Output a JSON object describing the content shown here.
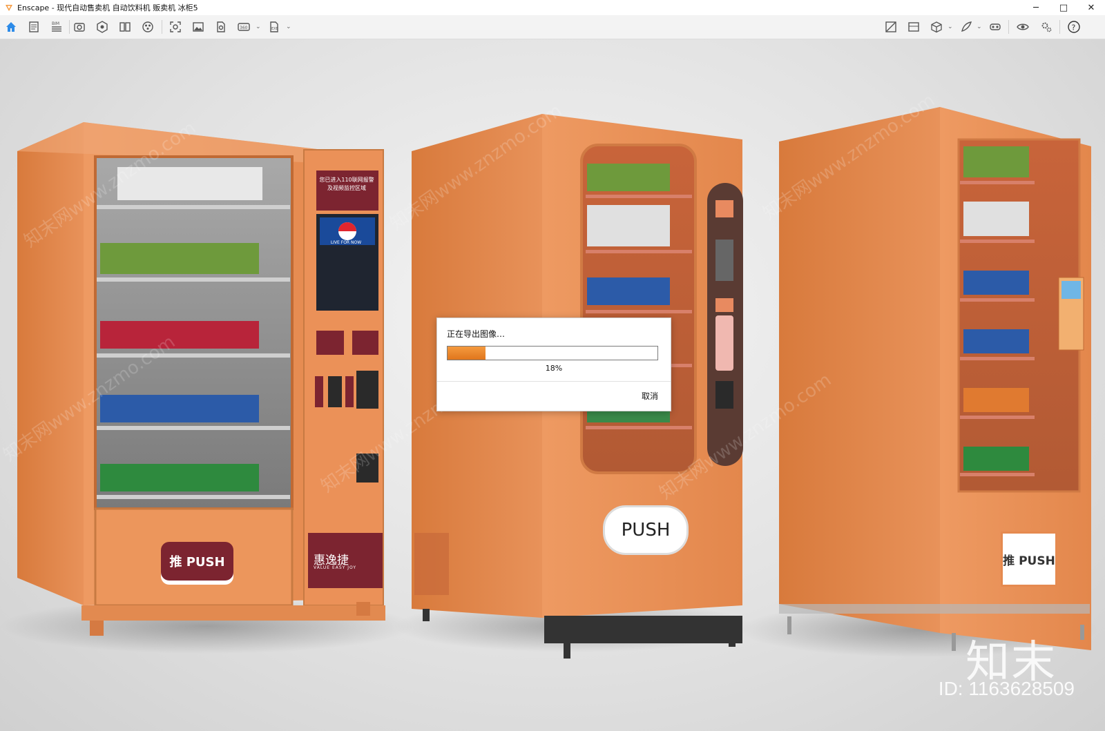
{
  "window": {
    "title": "Enscape - 现代自动售卖机 自动饮料机 贩卖机 冰柜5",
    "minimize": "─",
    "maximize": "□",
    "close": "✕"
  },
  "toolbar": {
    "left_icons": [
      "home-icon",
      "document-icon",
      "list-icon",
      "camera-view-icon",
      "bim-icon",
      "book-icon",
      "asset-icon",
      "screenshot-icon",
      "image-icon",
      "export-icon",
      "panorama-icon",
      "exe-icon"
    ],
    "right_icons": [
      "material-icon",
      "atmosphere-icon",
      "cube-icon",
      "feather-icon",
      "vr-icon",
      "eye-icon",
      "settings-icon",
      "help-icon"
    ],
    "bim_label": "BIM",
    "panorama_label": "360",
    "exe_label": "EXE",
    "collapse": "⌃"
  },
  "scene": {
    "left_machine": {
      "push_label": "推 PUSH",
      "brand": "惠逸捷",
      "brand_sub": "VALUE EASY JOY",
      "sign": "您已进入110联网报警及视频监控区域",
      "screen_text": "LIVE FOR NOW"
    },
    "middle_machine": {
      "push_label": "PUSH"
    },
    "right_machine": {
      "push_label": "推 PUSH"
    },
    "watermark_text": "知末网www.znzmo.com",
    "brand_mark": "知末",
    "brand_id": "ID: 1163628509"
  },
  "dialog": {
    "message": "正在导出图像…",
    "progress": 18,
    "progress_text": "18%",
    "cancel_label": "取消"
  },
  "colors": {
    "accent": "#f59a3f",
    "machine_orange": "#e38a4f",
    "brand_red": "#7c2430"
  }
}
